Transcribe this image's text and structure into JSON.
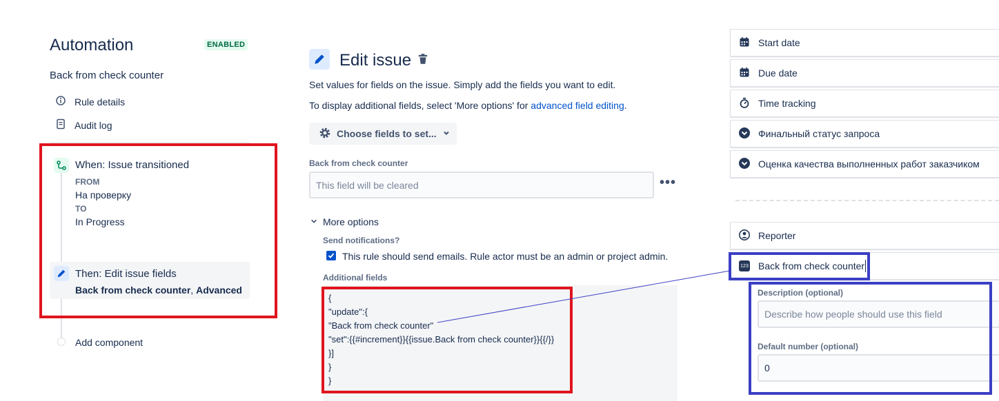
{
  "left": {
    "title": "Automation",
    "status": "ENABLED",
    "rule_name": "Back from check counter",
    "nav": [
      {
        "label": "Rule details",
        "icon": "info-icon"
      },
      {
        "label": "Audit log",
        "icon": "document-icon"
      }
    ],
    "trigger": {
      "label": "When: Issue transitioned",
      "from_label": "FROM",
      "from_value": "На проверку",
      "to_label": "TO",
      "to_value": "In Progress"
    },
    "action": {
      "label": "Then: Edit issue fields",
      "fields": "Back from check counter",
      "sep": ", ",
      "advanced": "Advanced"
    },
    "add_component": "Add component"
  },
  "middle": {
    "title": "Edit issue",
    "desc1": "Set values for fields on the issue. Simply add the fields you want to edit.",
    "desc2_prefix": "To display additional fields, select 'More options' for ",
    "desc2_link": "advanced field editing",
    "desc2_suffix": ".",
    "choose_fields": "Choose fields to set...",
    "field_label": "Back from check counter",
    "field_placeholder": "This field will be cleared",
    "more_options": "More options",
    "send_notifications_label": "Send notifications?",
    "send_notifications_text": "This rule should send emails. Rule actor must be an admin or project admin.",
    "send_notifications_checked": true,
    "additional_fields_label": "Additional fields",
    "code_lines": [
      "{",
      "\"update\":{",
      "\"Back from check counter\"",
      "\"set\":{{#increment}}{{issue.Back from check counter}}{{/}}",
      "}]",
      "}",
      "}"
    ]
  },
  "right": {
    "fields": [
      {
        "label": "Start date",
        "icon": "calendar-icon"
      },
      {
        "label": "Due date",
        "icon": "calendar-icon"
      },
      {
        "label": "Time tracking",
        "icon": "stopwatch-icon"
      },
      {
        "label": "Финальный статус запроса",
        "icon": "chevron-circle-icon"
      },
      {
        "label": "Оценка качества выполненных работ заказчиком",
        "icon": "chevron-circle-icon"
      }
    ],
    "reporter": "Reporter",
    "number_field": "Back from check counter",
    "number_icon_text": "123",
    "description_label": "Description (optional)",
    "description_placeholder": "Describe how people should use this field",
    "default_label": "Default number (optional)",
    "default_value": "0"
  },
  "colors": {
    "annotation_red": "#e0141e",
    "annotation_blue": "#3b3fc4",
    "link": "#0052cc",
    "badge_bg": "#e3fcef"
  }
}
